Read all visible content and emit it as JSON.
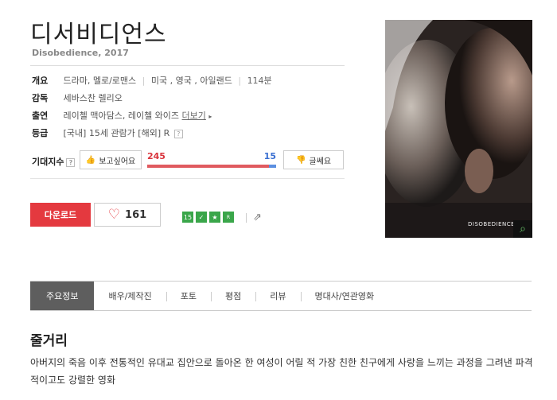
{
  "movie": {
    "title": "디서비디언스",
    "subtitle": "Disobedience, 2017"
  },
  "info": {
    "overview_label": "개요",
    "genre": "드라마, 멜로/로맨스",
    "country": "미국 , 영국 , 아일랜드",
    "runtime": "114분",
    "director_label": "감독",
    "director": "세바스찬 렐리오",
    "cast_label": "출연",
    "cast": "레이첼 맥아담스, 레이첼 와이즈",
    "more_label": "더보기",
    "rating_label": "등급",
    "rating_domestic": "[국내] 15세 관람가",
    "rating_foreign": "[해외] R",
    "help_glyph": "?"
  },
  "expect": {
    "label": "기대지수",
    "want_label": "보고싶어요",
    "want_count": 245,
    "notwant_count": 15,
    "notwant_label": "글쎄요",
    "want_count_text": "245",
    "notwant_count_text": "15"
  },
  "actions": {
    "download_label": "다운로드",
    "like_count": "161"
  },
  "badges": [
    "15",
    "✓",
    "★",
    "R"
  ],
  "poster": {
    "title_text": "DISOBEDIENCE"
  },
  "tabs": [
    {
      "label": "주요정보",
      "active": true
    },
    {
      "label": "배우/제작진",
      "active": false
    },
    {
      "label": "포토",
      "active": false
    },
    {
      "label": "평점",
      "active": false
    },
    {
      "label": "리뷰",
      "active": false
    },
    {
      "label": "명대사/연관영화",
      "active": false
    }
  ],
  "synopsis": {
    "heading": "줄거리",
    "text": "아버지의 죽음 이후 전통적인 유대교 집안으로 돌아온 한 여성이 어릴 적 가장 친한 친구에게 사랑을 느끼는 과정을 그려낸 파격적이고도 강렬한 영화"
  },
  "colors": {
    "accent_red": "#e4393f",
    "accent_blue": "#3a6fd1",
    "badge_green": "#3aa64a",
    "tab_active": "#5e5e5e"
  }
}
